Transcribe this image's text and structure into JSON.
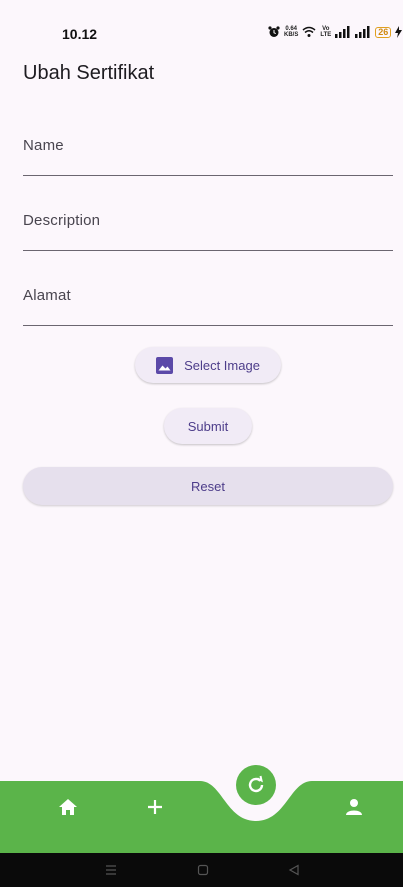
{
  "status_bar": {
    "time": "10.12",
    "network_speed_top": "0.64",
    "network_speed_unit": "KB/S",
    "vo_top": "Vo",
    "vo_bottom": "LTE",
    "battery": "26"
  },
  "page": {
    "title": "Ubah Sertifikat"
  },
  "form": {
    "name_label": "Name",
    "name_value": "",
    "description_label": "Description",
    "description_value": "",
    "alamat_label": "Alamat",
    "alamat_value": "",
    "select_image_label": "Select Image",
    "submit_label": "Submit",
    "reset_label": "Reset"
  },
  "bottom_nav": {
    "items": [
      "home-icon",
      "add-icon",
      "refresh-icon",
      "person-icon"
    ],
    "accent_color": "#5bb44a"
  },
  "system_nav": {
    "items": [
      "menu-icon",
      "square-icon",
      "back-icon"
    ]
  },
  "colors": {
    "background": "#fcf7fc",
    "button_bg": "#f1ebf6",
    "button_text": "#4d3d8a",
    "nav_green": "#5bb44a"
  }
}
